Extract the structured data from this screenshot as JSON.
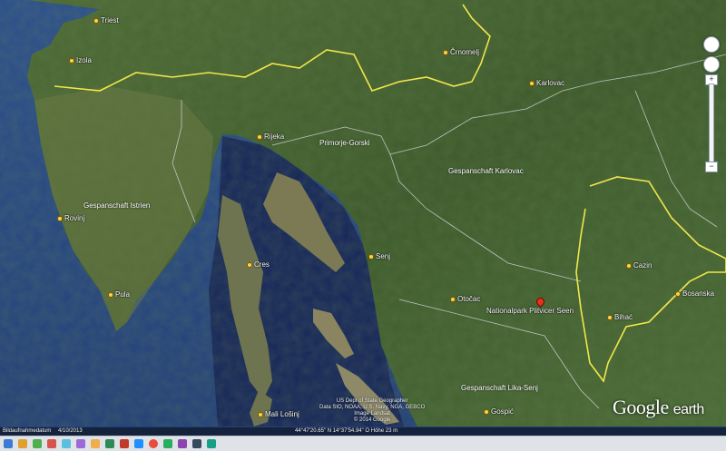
{
  "map": {
    "places": [
      {
        "key": "triest",
        "name": "Triest"
      },
      {
        "key": "izola",
        "name": "Izola"
      },
      {
        "key": "crnomelj",
        "name": "Črnomelj"
      },
      {
        "key": "karlovac",
        "name": "Karlovac"
      },
      {
        "key": "rijeka",
        "name": "Rijeka"
      },
      {
        "key": "rovinj",
        "name": "Rovinj"
      },
      {
        "key": "senj",
        "name": "Senj"
      },
      {
        "key": "cres",
        "name": "Cres"
      },
      {
        "key": "pula",
        "name": "Pula"
      },
      {
        "key": "otocac",
        "name": "Otočac"
      },
      {
        "key": "cazin",
        "name": "Cazin"
      },
      {
        "key": "bosanska",
        "name": "Bosanska"
      },
      {
        "key": "bihac",
        "name": "Bihać"
      },
      {
        "key": "mali_losinj",
        "name": "Mali Lošinj"
      },
      {
        "key": "gospic",
        "name": "Gospić"
      }
    ],
    "regions": [
      {
        "key": "primorje",
        "name": "Primorje-Gorski"
      },
      {
        "key": "karlovac_county",
        "name": "Gespanschaft Karlovac"
      },
      {
        "key": "istrien",
        "name": "Gespanschaft Istrien"
      },
      {
        "key": "lika_senj",
        "name": "Gespanschaft Lika-Senj"
      }
    ],
    "poi": {
      "name": "Nationalpark Plitvicer Seen"
    }
  },
  "credits": {
    "line1": "US Dept of State Geographer",
    "line2": "Data SIO, NOAA, U.S. Navy, NGA, GEBCO",
    "line3": "Image Landsat",
    "line4": "© 2014 Google"
  },
  "logo": {
    "google": "Google",
    "earth": "earth"
  },
  "status": {
    "image_date_label": "Bildaufnahmedatum",
    "image_date": "4/10/2013",
    "coordinates": "44°47'20.65\" N  14°37'54.94\" O  Höhe  23 m"
  },
  "colors": {
    "land": "#55703a",
    "sea": "#1a2f5c",
    "border_yellow": "#f2e64a",
    "admin_border": "#d8dde3"
  }
}
